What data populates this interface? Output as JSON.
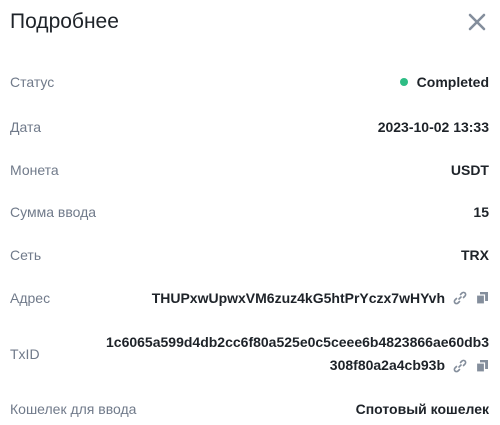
{
  "header": {
    "title": "Подробнее",
    "close_icon": "close-icon"
  },
  "colors": {
    "status_dot": "#2ebd85",
    "label": "#707a8a",
    "value": "#1e2329",
    "icon": "#707a8a"
  },
  "rows": {
    "status": {
      "label": "Статус",
      "value": "Completed"
    },
    "date": {
      "label": "Дата",
      "value": "2023-10-02 13:33"
    },
    "coin": {
      "label": "Монета",
      "value": "USDT"
    },
    "amount": {
      "label": "Сумма ввода",
      "value": "15"
    },
    "network": {
      "label": "Сеть",
      "value": "TRX"
    },
    "address": {
      "label": "Адрес",
      "value": "THUPxwUpwxVM6zuz4kG5htPrYczx7wHYvh"
    },
    "txid": {
      "label": "TxID",
      "value_line1": "1c6065a599d4db2cc6f80a525e0c5ceee6b4823866ae60db3",
      "value_line2": "308f80a2a4cb93b"
    },
    "wallet": {
      "label": "Кошелек для ввода",
      "value": "Спотовый кошелек"
    }
  },
  "icons": {
    "link": "link-icon",
    "copy": "copy-icon"
  }
}
